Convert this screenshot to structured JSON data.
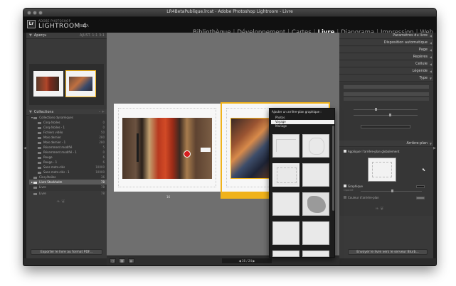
{
  "window": {
    "title": "LR4BetaPublique.lrcat - Adobe Photoshop Lightroom - Livre"
  },
  "identity": {
    "logo": "Lr",
    "product_small": "ADOBE PHOTOSHOP",
    "product": "LIGHTROOM 4",
    "edition": "BETA"
  },
  "modules": [
    {
      "label": "Bibliothèque",
      "active": false
    },
    {
      "label": "Développement",
      "active": false
    },
    {
      "label": "Cartes",
      "active": false
    },
    {
      "label": "Livre",
      "active": true
    },
    {
      "label": "Diaporama",
      "active": false
    },
    {
      "label": "Impression",
      "active": false
    },
    {
      "label": "Web",
      "active": false
    }
  ],
  "module_separator": "|",
  "left_panel": {
    "navigator": {
      "title": "Aperçu",
      "controls": "AJUST.  1:1  3:1"
    },
    "collections": {
      "title": "Collections",
      "controls": "–  +",
      "items": [
        {
          "label": "Collections dynamiques",
          "count": ""
        },
        {
          "label": "Cinq étoiles",
          "count": "0"
        },
        {
          "label": "Cinq étoiles - 1",
          "count": "0"
        },
        {
          "label": "Fichiers vidéo",
          "count": "50"
        },
        {
          "label": "Mois dernier",
          "count": "280"
        },
        {
          "label": "Mois dernier - 1",
          "count": "280"
        },
        {
          "label": "Récemment modifié",
          "count": "5"
        },
        {
          "label": "Récemment modifié - 1",
          "count": "0"
        },
        {
          "label": "Rouge",
          "count": "6"
        },
        {
          "label": "Rouge - 1",
          "count": "6"
        },
        {
          "label": "Sans mots-clés",
          "count": "10000"
        },
        {
          "label": "Sans mots-clés - 1",
          "count": "10000"
        },
        {
          "label": "Cinq étoiles",
          "count": "36"
        },
        {
          "label": "Livre Stockholm",
          "count": "78",
          "selected": true
        },
        {
          "label": "Livre",
          "count": "78"
        },
        {
          "label": "Livre",
          "count": "78"
        }
      ]
    },
    "export_button": "Exporter le livre au format PDF..."
  },
  "center": {
    "page_number_label": "16",
    "popup": {
      "title": "Ajouter un arrière-plan graphique :",
      "options": [
        "Photos",
        "Voyage",
        "Mariage"
      ],
      "selected_index": 1
    },
    "bottom_toolbar": {
      "view_buttons": [
        "□",
        "▥",
        "▤"
      ],
      "page_nav": "◀   16  /  24   ▶"
    }
  },
  "right_panel": {
    "sections": [
      "Paramètres du livre",
      "Disposition automatique",
      "Page",
      "Repères",
      "Cellule",
      "Légende",
      "Type"
    ],
    "background": {
      "title": "Arrière-plan",
      "apply_global": "Appliquer l'arrière-plan globalement",
      "graphic_label": "Graphique",
      "opacity_label": "Opacité",
      "color_label": "Couleur d'arrière-plan"
    },
    "send_button": "Envoyer le livre vers le serveur Blurb..."
  },
  "colors": {
    "selection_yellow": "#f0b21a",
    "center_bg": "#6f6f6f",
    "panel_bg": "#393939"
  }
}
